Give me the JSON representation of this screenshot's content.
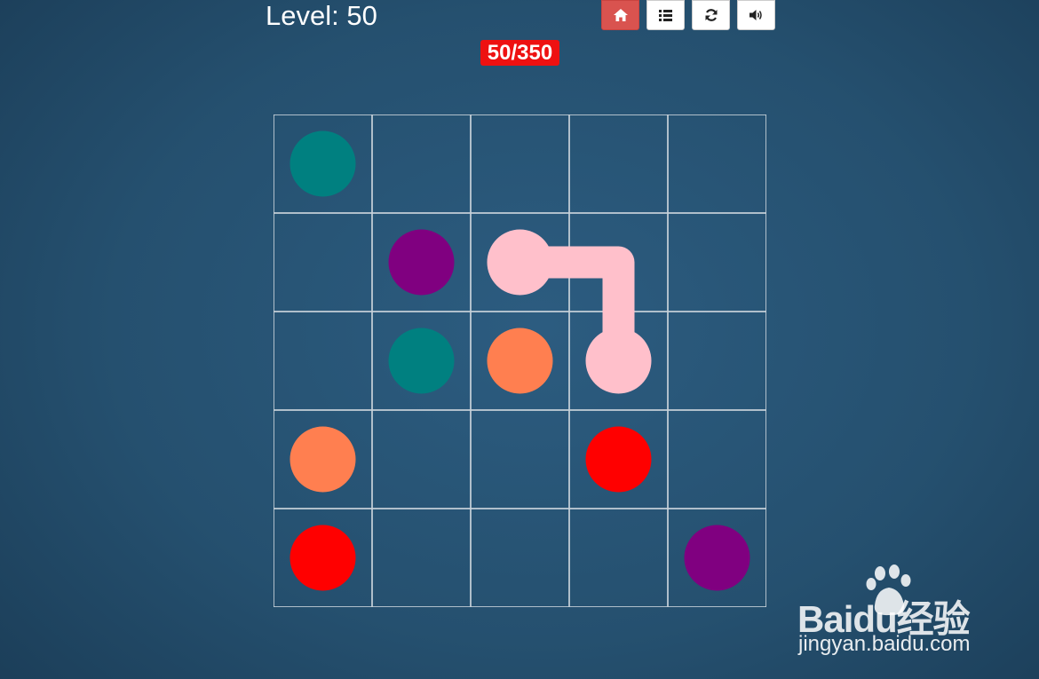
{
  "header": {
    "level_text": "Level: 50",
    "progress": "50/350"
  },
  "toolbar": {
    "buttons": [
      {
        "icon": "home-icon",
        "active": true,
        "color": "#d9534f"
      },
      {
        "icon": "list-icon",
        "active": false,
        "color": "#ffffff"
      },
      {
        "icon": "refresh-icon",
        "active": false,
        "color": "#ffffff"
      },
      {
        "icon": "volume-icon",
        "active": false,
        "color": "#ffffff"
      }
    ]
  },
  "board": {
    "rows": 5,
    "cols": 5,
    "grid_color": "#c8d2da",
    "colors": {
      "teal": "#008080",
      "purple": "#800080",
      "pink": "#ffc0cb",
      "coral": "#ff7f50",
      "red": "#ff0000"
    },
    "dots": [
      {
        "color": "teal",
        "row": 0,
        "col": 0
      },
      {
        "color": "purple",
        "row": 1,
        "col": 1
      },
      {
        "color": "pink",
        "row": 1,
        "col": 2
      },
      {
        "color": "teal",
        "row": 2,
        "col": 1
      },
      {
        "color": "coral",
        "row": 2,
        "col": 2
      },
      {
        "color": "pink",
        "row": 2,
        "col": 3
      },
      {
        "color": "coral",
        "row": 3,
        "col": 0
      },
      {
        "color": "red",
        "row": 3,
        "col": 3
      },
      {
        "color": "red",
        "row": 4,
        "col": 0
      },
      {
        "color": "purple",
        "row": 4,
        "col": 4
      }
    ],
    "paths": [
      {
        "color": "pink",
        "cells": [
          [
            1,
            2
          ],
          [
            1,
            3
          ],
          [
            2,
            3
          ]
        ]
      }
    ]
  },
  "watermark": {
    "brand": "Baidu经验",
    "url": "jingyan.baidu.com"
  }
}
